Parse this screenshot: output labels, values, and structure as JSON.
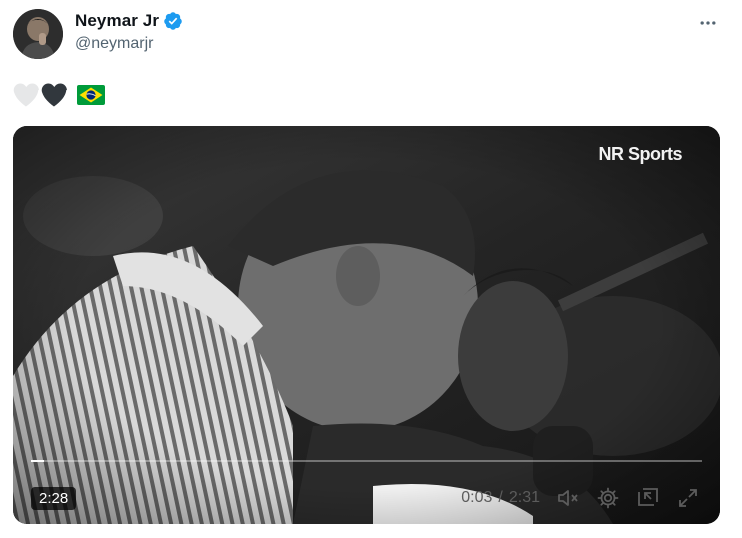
{
  "author": {
    "display_name": "Neymar Jr",
    "handle": "@neymarjr",
    "verified": true,
    "verified_color": "#1d9bf0"
  },
  "tweet": {
    "emojis": [
      "white-heart-icon",
      "black-heart-icon",
      "brazil-flag-icon"
    ]
  },
  "video": {
    "watermark": "NR Sports",
    "duration_badge": "2:28",
    "current_time": "0:03",
    "time_separator": "/",
    "total_time": "2:31",
    "progress_fraction": 0.02
  }
}
